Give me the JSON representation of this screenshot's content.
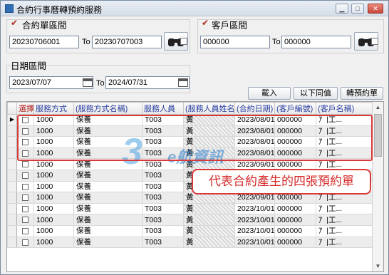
{
  "window": {
    "title": "合約行事曆轉預約服務"
  },
  "contract_range": {
    "title": "合約單區間",
    "from_value": "20230706001",
    "to_label": "To",
    "to_value": "20230707003"
  },
  "customer_range": {
    "title": "客戶區間",
    "from_value": "000000",
    "to_label": "To",
    "to_value": "000000"
  },
  "date_range": {
    "title": "日期區間",
    "from_value": "2023/07/07",
    "to_label": "To",
    "to_value": "2024/07/31"
  },
  "buttons": {
    "load": "載入",
    "same_below": "以下同值",
    "convert": "轉預約單"
  },
  "grid": {
    "columns": [
      "選擇",
      "服務方式",
      "(服務方式名稱)",
      "服務人員",
      "(服務人員姓名)",
      "(合約日期)",
      "(客戶編號)",
      "(客戶名稱)"
    ],
    "rows": [
      {
        "service": "1000",
        "service_name": "保養",
        "staff": "T003",
        "staff_name": "黃",
        "date": "2023/08/01",
        "cust": "000000",
        "cust_name": "ｱ",
        "extra": "|工..."
      },
      {
        "service": "1000",
        "service_name": "保養",
        "staff": "T003",
        "staff_name": "黃",
        "date": "2023/08/01",
        "cust": "000000",
        "cust_name": "ｱ",
        "extra": "|工..."
      },
      {
        "service": "1000",
        "service_name": "保養",
        "staff": "T003",
        "staff_name": "黃",
        "date": "2023/08/01",
        "cust": "000000",
        "cust_name": "ｱ",
        "extra": "|工..."
      },
      {
        "service": "1000",
        "service_name": "保養",
        "staff": "T003",
        "staff_name": "黃",
        "date": "2023/08/01",
        "cust": "000000",
        "cust_name": "ｱ",
        "extra": "|工..."
      },
      {
        "service": "1000",
        "service_name": "保養",
        "staff": "T003",
        "staff_name": "黃",
        "date": "2023/09/01",
        "cust": "000000",
        "cust_name": "ｱ",
        "extra": "|工..."
      },
      {
        "service": "1000",
        "service_name": "保養",
        "staff": "T003",
        "staff_name": "黃",
        "date": "2023/09/01",
        "cust": "000000",
        "cust_name": "ｱ",
        "extra": "|工..."
      },
      {
        "service": "1000",
        "service_name": "保養",
        "staff": "T003",
        "staff_name": "黃",
        "date": "2023/09/01",
        "cust": "000000",
        "cust_name": "ｱ",
        "extra": "|工..."
      },
      {
        "service": "1000",
        "service_name": "保養",
        "staff": "T003",
        "staff_name": "黃",
        "date": "2023/09/01",
        "cust": "000000",
        "cust_name": "ｱ",
        "extra": "|工..."
      },
      {
        "service": "1000",
        "service_name": "保養",
        "staff": "T003",
        "staff_name": "黃",
        "date": "2023/10/01",
        "cust": "000000",
        "cust_name": "ｱ",
        "extra": "|工..."
      },
      {
        "service": "1000",
        "service_name": "保養",
        "staff": "T003",
        "staff_name": "黃",
        "date": "2023/10/01",
        "cust": "000000",
        "cust_name": "ｱ",
        "extra": "|工..."
      },
      {
        "service": "1000",
        "service_name": "保養",
        "staff": "T003",
        "staff_name": "黃",
        "date": "2023/10/01",
        "cust": "000000",
        "cust_name": "ｱ",
        "extra": "|工..."
      },
      {
        "service": "1000",
        "service_name": "保養",
        "staff": "T003",
        "staff_name": "黃",
        "date": "2023/10/01",
        "cust": "000000",
        "cust_name": "ｱ",
        "extra": "|工..."
      }
    ]
  },
  "annotation": {
    "callout_text": "代表合約產生的四張預約單"
  },
  "watermark": {
    "logo_number": "3",
    "logo_text": "e航資訊"
  },
  "colors": {
    "annotation_red": "#d83a3a",
    "header_blue": "#2a3fa0"
  }
}
